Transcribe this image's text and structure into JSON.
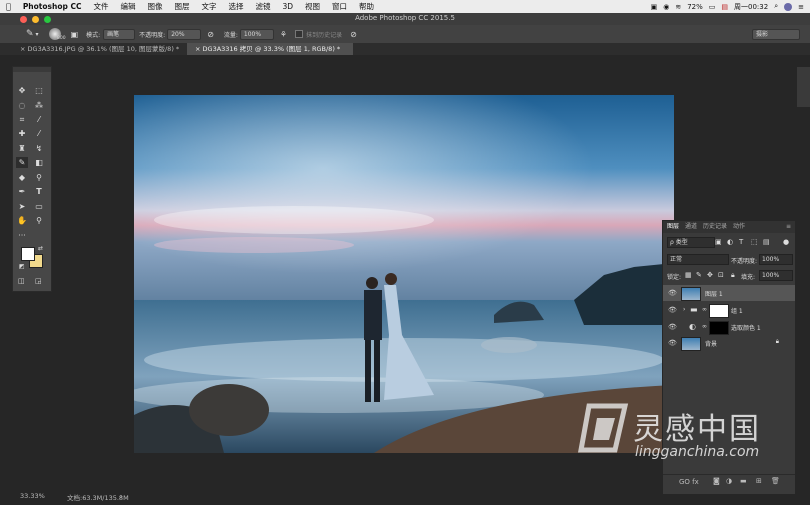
{
  "menubar": {
    "app_name": "Photoshop CC",
    "items": [
      "文件",
      "编辑",
      "图像",
      "图层",
      "文字",
      "选择",
      "滤镜",
      "3D",
      "视图",
      "窗口",
      "帮助"
    ],
    "battery": "72%",
    "clock": "周一00:32"
  },
  "window": {
    "title": "Adobe Photoshop CC 2015.5"
  },
  "options": {
    "brush_size": "800",
    "mode_label": "模式:",
    "mode_value": "画笔",
    "opacity_label": "不透明度:",
    "opacity_value": "20%",
    "flow_label": "流量:",
    "flow_value": "100%",
    "history_label": "抹到历史记录",
    "workspace": "摄影"
  },
  "tabs": [
    {
      "label": "DG3A3316.JPG @ 36.1% (图层 10, 图层蒙版/8) *"
    },
    {
      "label": "DG3A3316 拷贝 @ 33.3% (图层 1, RGB/8) *"
    }
  ],
  "layers_panel": {
    "tabs": [
      "图层",
      "通道",
      "历史记录",
      "动作"
    ],
    "filter_label": "ρ 类型",
    "blend_mode": "正常",
    "opacity_label": "不透明度:",
    "opacity_value": "100%",
    "lock_label": "锁定:",
    "fill_label": "填充:",
    "fill_value": "100%",
    "layers": [
      {
        "name": "图层 1"
      },
      {
        "name": "组 1"
      },
      {
        "name": "选取颜色 1"
      },
      {
        "name": "背景"
      }
    ],
    "footer_icons": "GO fx"
  },
  "status": {
    "zoom": "33.33%",
    "doc": "文档:63.3M/135.8M"
  },
  "watermark": {
    "chinese": "灵感中国",
    "url": "lingganchina.com"
  }
}
